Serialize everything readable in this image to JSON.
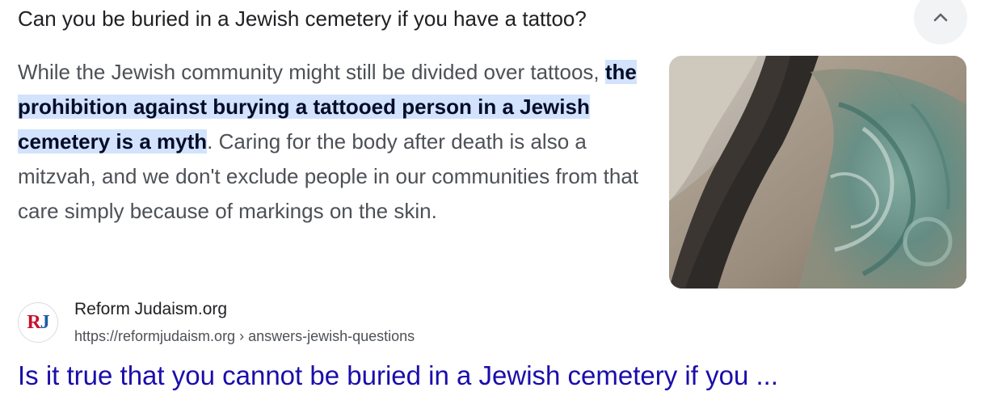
{
  "question": {
    "text": "Can you be buried in a Jewish cemetery if you have a tattoo?",
    "collapse_icon": "chevron-up-icon"
  },
  "answer": {
    "before_highlight": "While the Jewish community might still be divided over tattoos, ",
    "highlight": "the prohibition against burying a tattooed person in a Jewish cemetery is a myth",
    "after_highlight": ". Caring for the body after death is also a mitzvah, and we don't exclude people in our communities from that care simply because of markings on the skin."
  },
  "thumbnail": {
    "icon": "tattooed-shoulder-image"
  },
  "source": {
    "favicon_letters": [
      "R",
      "J"
    ],
    "site_name": "Reform Judaism.org",
    "url": "https://reformjudaism.org › answers-jewish-questions"
  },
  "result": {
    "title": "Is it true that you cannot be buried in a Jewish cemetery if you ..."
  },
  "colors": {
    "link": "#1a0dab",
    "highlight_bg": "#d3e3fd",
    "favicon_r": "#c8102e",
    "favicon_j": "#1f5aa6"
  }
}
